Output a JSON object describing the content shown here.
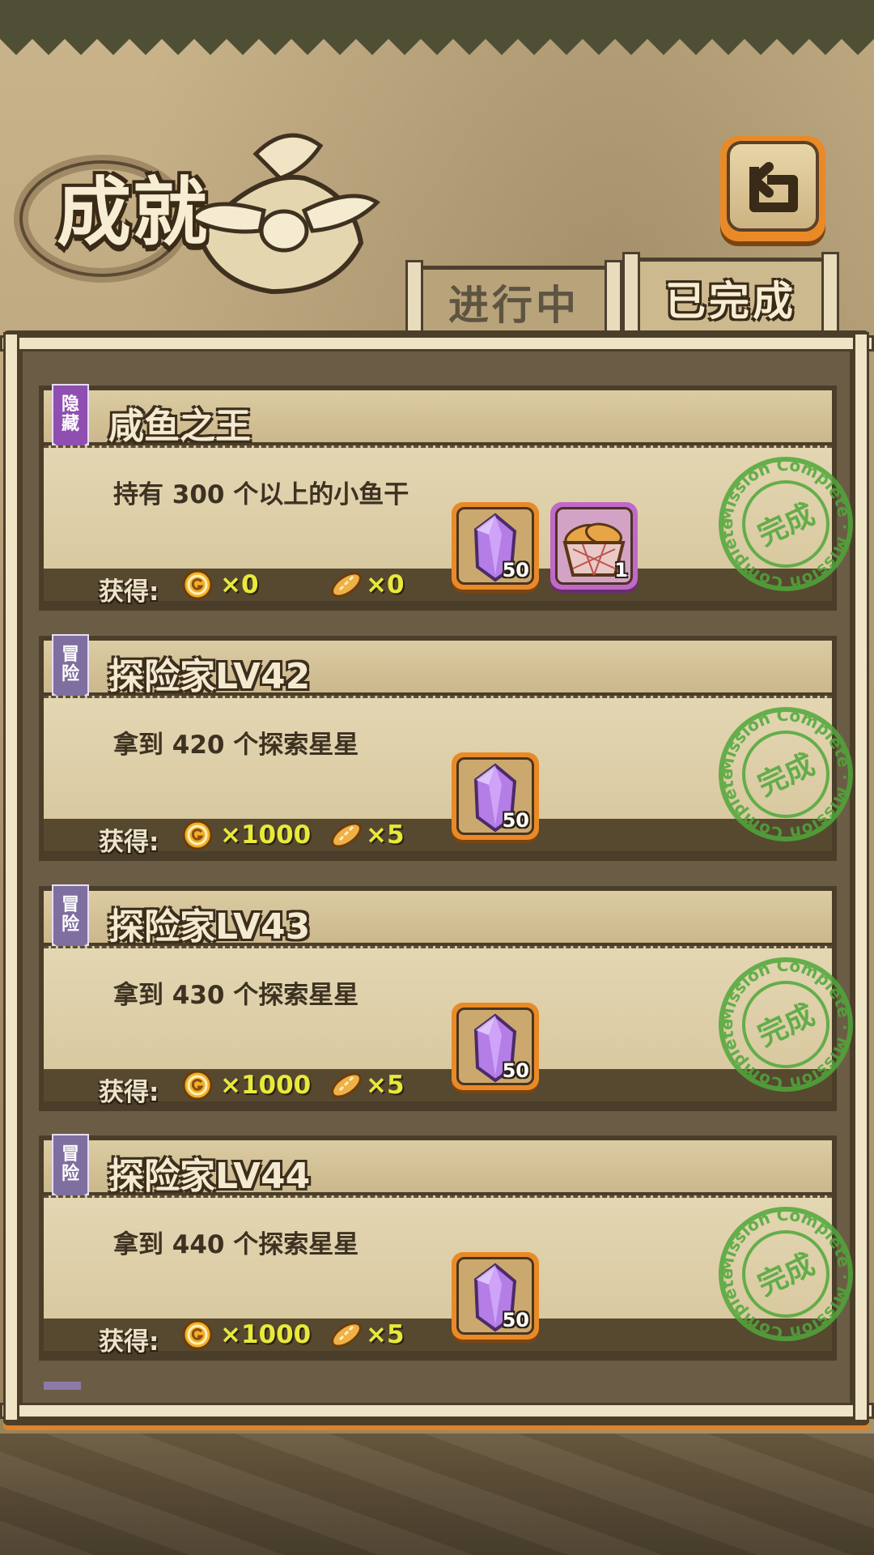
{
  "screen_title": "成就",
  "tabs": {
    "in_progress": "进行中",
    "completed": "已完成"
  },
  "colors": {
    "accent_orange": "#e98a27",
    "stamp_green": "#4fa83a",
    "value_yellow": "#e8e93a",
    "hidden_badge": "#8e4fb0",
    "adventure_badge": "#7f6fa0"
  },
  "icons": {
    "back": "return-arrow-icon",
    "coin": "gold-coin-icon",
    "bread": "bread-icon",
    "gem": "purple-gem-icon",
    "basket": "bread-basket-icon"
  },
  "gain_label": "获得:",
  "stamp": {
    "main": "完成",
    "ring": "Mission Complete"
  },
  "achievements": [
    {
      "badge": "隐藏",
      "badge_type": "hidden",
      "title": "咸鱼之王",
      "desc": "持有 300 个以上的小鱼干",
      "coin": "×0",
      "bread": "×0",
      "rewards": [
        {
          "icon": "purple-gem-icon",
          "qty": "50"
        },
        {
          "icon": "bread-basket-icon",
          "qty": "1"
        }
      ]
    },
    {
      "badge": "冒险",
      "badge_type": "adventure",
      "title": "探险家LV42",
      "desc": "拿到 420 个探索星星",
      "coin": "×1000",
      "bread": "×5",
      "rewards": [
        {
          "icon": "purple-gem-icon",
          "qty": "50"
        }
      ]
    },
    {
      "badge": "冒险",
      "badge_type": "adventure",
      "title": "探险家LV43",
      "desc": "拿到 430 个探索星星",
      "coin": "×1000",
      "bread": "×5",
      "rewards": [
        {
          "icon": "purple-gem-icon",
          "qty": "50"
        }
      ]
    },
    {
      "badge": "冒险",
      "badge_type": "adventure",
      "title": "探险家LV44",
      "desc": "拿到 440 个探索星星",
      "coin": "×1000",
      "bread": "×5",
      "rewards": [
        {
          "icon": "purple-gem-icon",
          "qty": "50"
        }
      ]
    }
  ]
}
